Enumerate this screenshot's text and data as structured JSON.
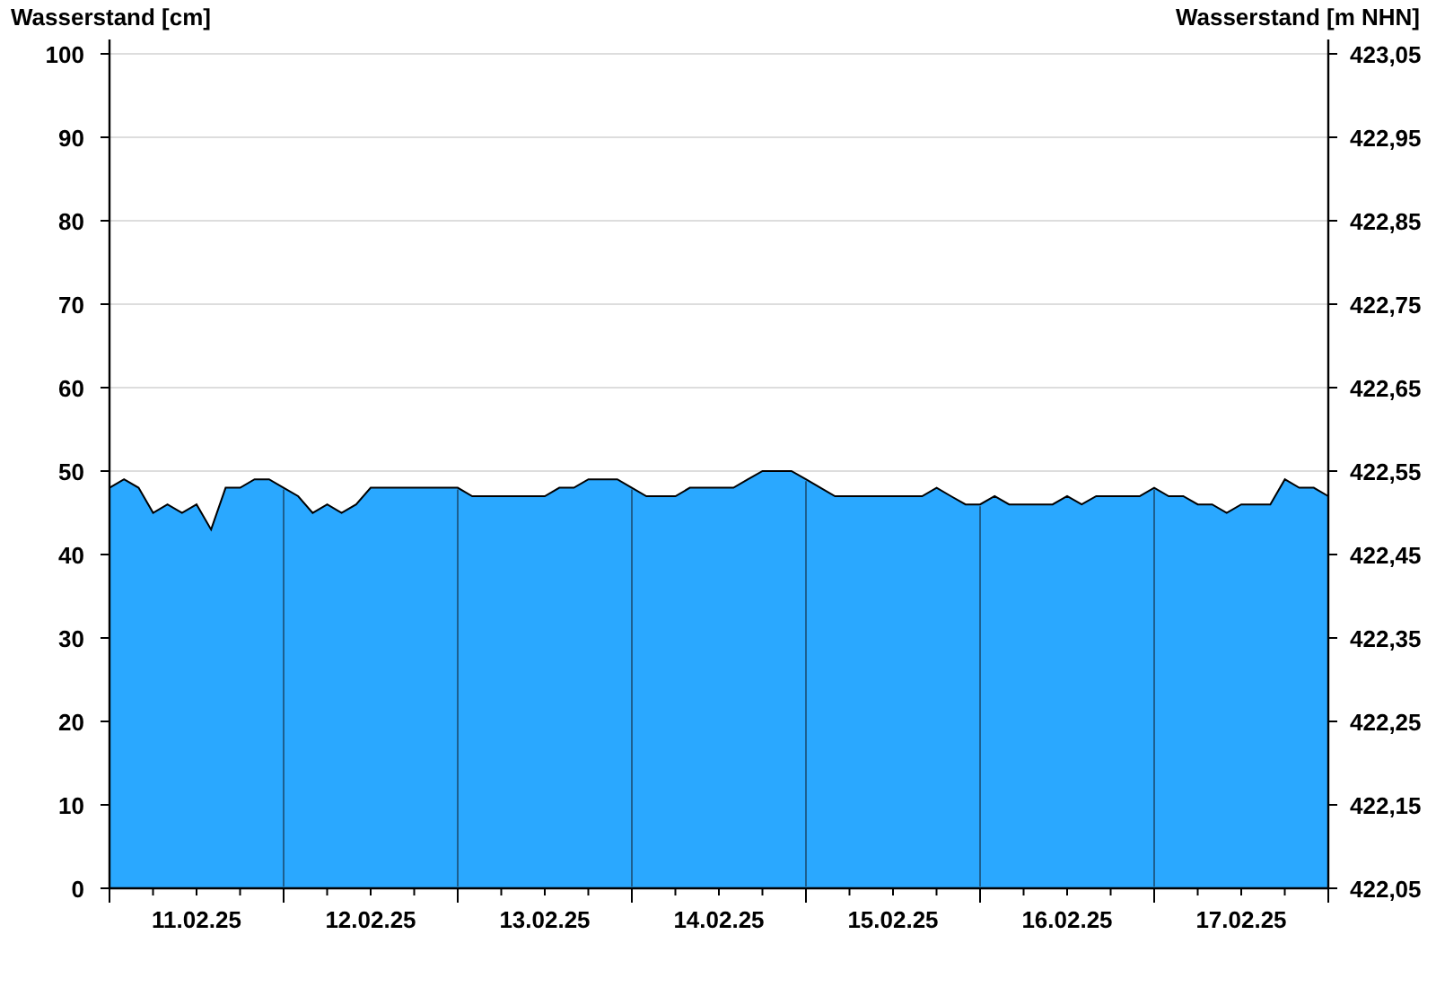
{
  "chart_data": {
    "type": "area",
    "ylabel": "Wasserstand [cm]",
    "grid": true,
    "ylim": [
      0,
      100
    ],
    "yticks": [
      0,
      10,
      20,
      30,
      40,
      50,
      60,
      70,
      80,
      90,
      100
    ],
    "categories": [
      null,
      null,
      null,
      null,
      null,
      null,
      "11.02.25",
      null,
      null,
      null,
      null,
      null,
      null,
      null,
      null,
      null,
      null,
      null,
      "12.02.25",
      null,
      null,
      null,
      null,
      null,
      null,
      null,
      null,
      null,
      null,
      null,
      "13.02.25",
      null,
      null,
      null,
      null,
      null,
      null,
      null,
      null,
      null,
      null,
      null,
      "14.02.25",
      null,
      null,
      null,
      null,
      null,
      null,
      null,
      null,
      null,
      null,
      null,
      "15.02.25",
      null,
      null,
      null,
      null,
      null,
      null,
      null,
      null,
      null,
      null,
      null,
      "16.02.25",
      null,
      null,
      null,
      null,
      null,
      null,
      null,
      null,
      null,
      null,
      null,
      "17.02.25",
      null,
      null,
      null,
      null,
      null,
      null
    ],
    "series": [
      {
        "color": "#2aa8ff",
        "values": [
          48,
          49,
          48,
          45,
          46,
          45,
          46,
          43,
          48,
          48,
          49,
          49,
          48,
          47,
          45,
          46,
          45,
          46,
          48,
          48,
          48,
          48,
          48,
          48,
          48,
          47,
          47,
          47,
          47,
          47,
          47,
          48,
          48,
          49,
          49,
          49,
          48,
          47,
          47,
          47,
          48,
          48,
          48,
          48,
          49,
          50,
          50,
          50,
          49,
          48,
          47,
          47,
          47,
          47,
          47,
          47,
          47,
          48,
          47,
          46,
          46,
          47,
          46,
          46,
          46,
          46,
          47,
          46,
          47,
          47,
          47,
          47,
          48,
          47,
          47,
          46,
          46,
          45,
          46,
          46,
          46,
          49,
          48,
          48,
          47
        ]
      }
    ]
  },
  "right_axis": {
    "title": "Wasserstand [m NHN]",
    "labels": [
      "423,05",
      "422,95",
      "422,85",
      "422,75",
      "422,65",
      "422,55",
      "422,45",
      "422,35",
      "422,25",
      "422,15",
      "422,05"
    ]
  }
}
